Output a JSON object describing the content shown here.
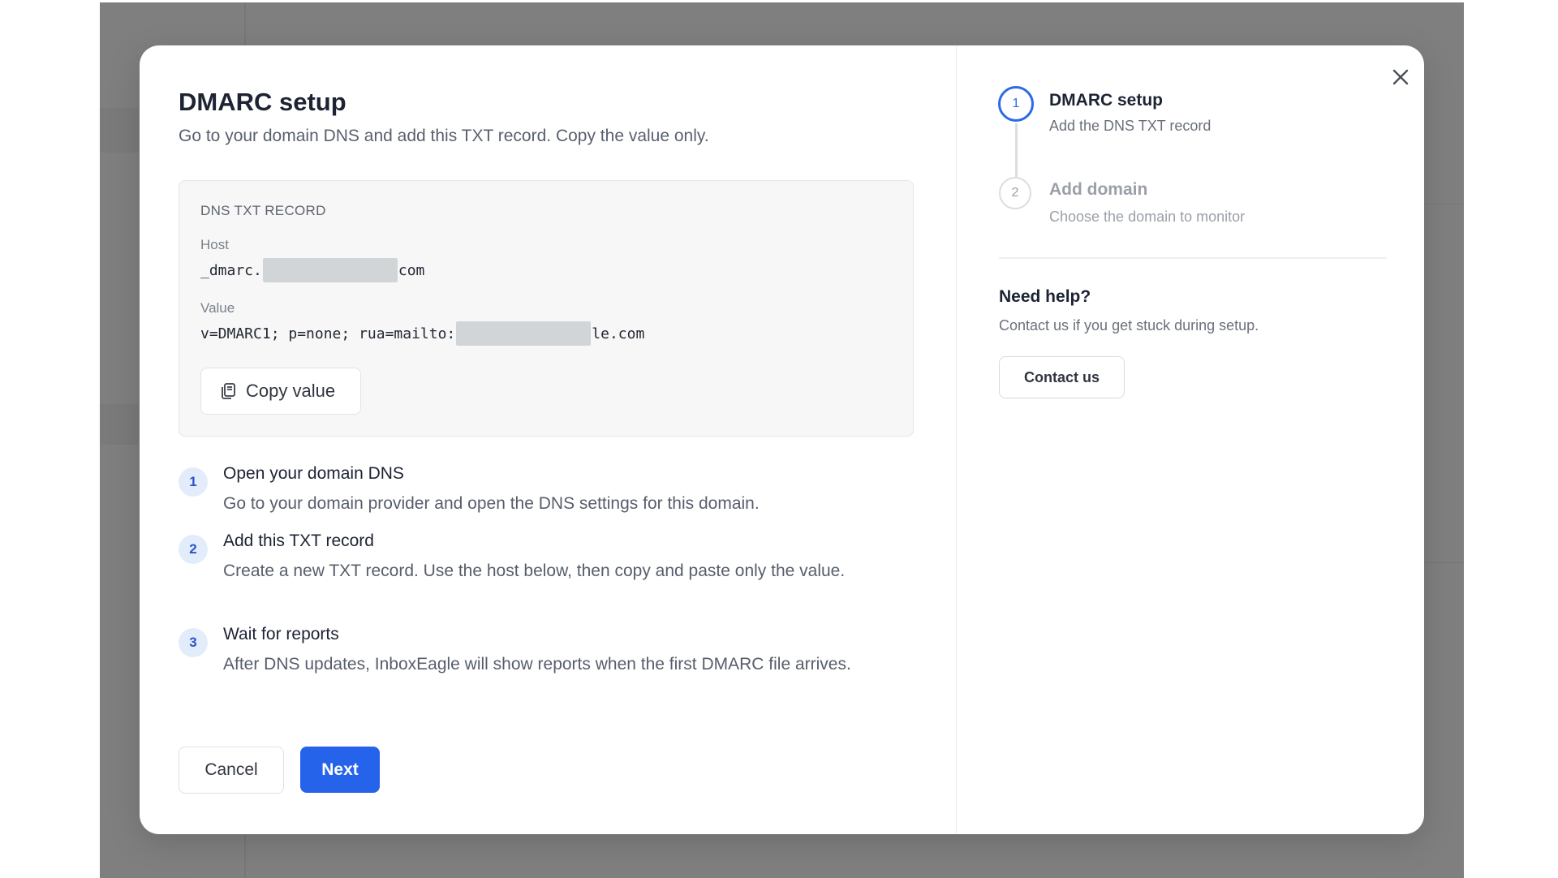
{
  "modal": {
    "title": "DMARC setup",
    "subtitle": "Go to your domain DNS and add this TXT record. Copy the value only.",
    "record": {
      "caption": "DNS TXT RECORD",
      "host_label": "Host",
      "host_prefix": "_dmarc.",
      "host_suffix": "com",
      "value_label": "Value",
      "value_prefix": "v=DMARC1; p=none; rua=mailto:",
      "value_suffix": "le.com",
      "copy_label": "Copy value"
    },
    "steps": [
      {
        "number": "1",
        "title": "Open your domain DNS",
        "description": "Go to your domain provider and open the DNS settings for this domain."
      },
      {
        "number": "2",
        "title": "Add this TXT record",
        "description": "Create a new TXT record. Use the host below, then copy and paste only the value."
      },
      {
        "number": "3",
        "title": "Wait for reports",
        "description": "After DNS updates, InboxEagle will show reports when the first DMARC file arrives."
      }
    ],
    "cancel_label": "Cancel",
    "next_label": "Next"
  },
  "wizard": {
    "steps": [
      {
        "number": "1",
        "title": "DMARC setup",
        "description": "Add the DNS TXT record",
        "state": "active"
      },
      {
        "number": "2",
        "title": "Add domain",
        "description": "Choose the domain to monitor",
        "state": "inactive"
      }
    ]
  },
  "help": {
    "title": "Need help?",
    "description": "Contact us if you get stuck during setup.",
    "contact_label": "Contact us"
  },
  "colors": {
    "accent": "#2563eb",
    "overlay": "#7f7f7f",
    "redaction": "#d2d5d8"
  },
  "icons": {
    "close": "close-icon",
    "copy": "copy-icon"
  }
}
